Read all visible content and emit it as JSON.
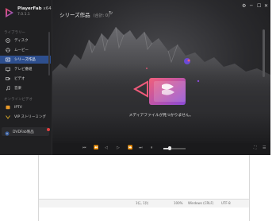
{
  "app": {
    "name": "PlayerFab",
    "arch": "x64",
    "version": "7.0.1.1"
  },
  "window": {
    "minimize": "─",
    "maximize": "☐",
    "close": "✕",
    "menu": "⚙"
  },
  "sidebar": {
    "library_section": "ライブラリー",
    "library_items": [
      {
        "label": "ディスク",
        "icon": "disc-icon"
      },
      {
        "label": "ムービー",
        "icon": "movie-icon"
      },
      {
        "label": "シリーズ作品",
        "icon": "series-icon",
        "active": true
      },
      {
        "label": "テレビ番組",
        "icon": "tv-icon"
      },
      {
        "label": "ビデオ",
        "icon": "video-icon"
      },
      {
        "label": "音楽",
        "icon": "music-icon"
      }
    ],
    "online_section": "オンラインビデオ",
    "online_items": [
      {
        "label": "IPTV",
        "icon": "iptv-icon"
      },
      {
        "label": "VIP ストリーミング",
        "icon": "vip-icon"
      }
    ],
    "dvd_item": "DVDFab製品"
  },
  "main": {
    "title": "シリーズ作品",
    "count": "(合計: 0)",
    "refresh_icon": "↻",
    "empty_message": "メディアファイルが見つかりません。"
  },
  "controls": {
    "buttons": [
      "⏮",
      "⏪",
      "◁",
      "▷",
      "⏩",
      "⏭",
      "⏸"
    ],
    "volume_icon": "🔈",
    "fullscreen_icon": "⛶",
    "menu_icon": "☰",
    "volume_level": 0.3
  },
  "editor_status": {
    "position": "1行, 1列",
    "zoom": "100%",
    "line_ending": "Windows (CRLF)",
    "encoding": "UTF-8"
  },
  "colors": {
    "accent": "#2e4f8e",
    "brand_pink": "#e8456e",
    "brand_purple": "#7a5cd6"
  }
}
